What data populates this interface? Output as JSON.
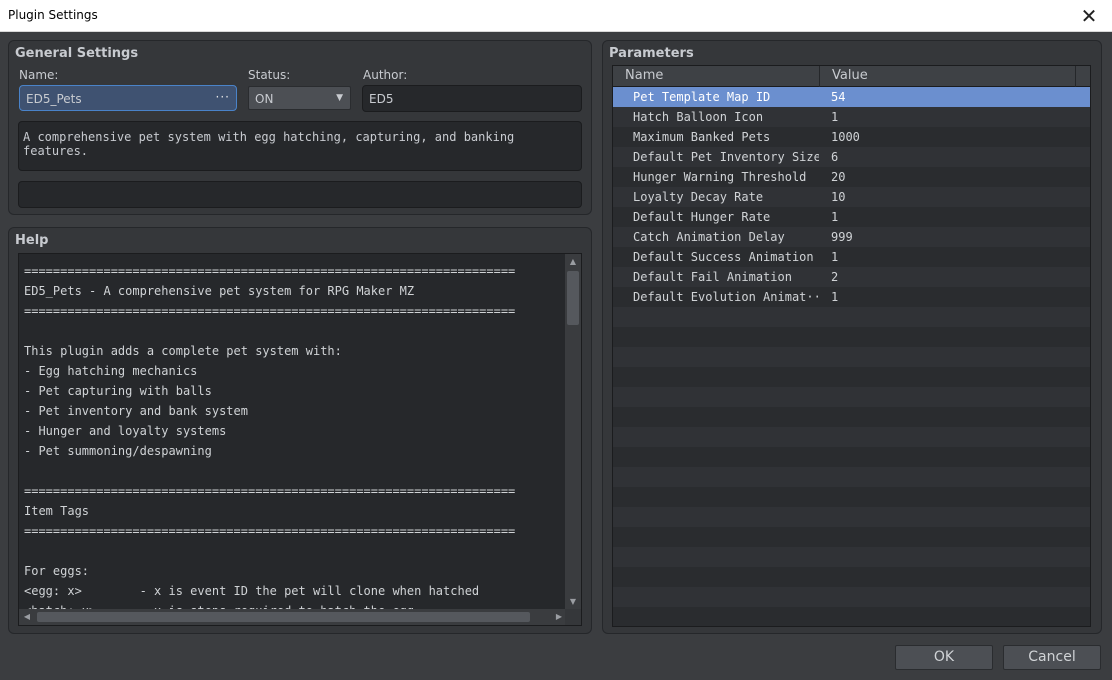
{
  "window": {
    "title": "Plugin Settings",
    "close_glyph": "✕"
  },
  "general": {
    "title": "General Settings",
    "name_label": "Name:",
    "name_value": "ED5_Pets",
    "name_dots": "···",
    "status_label": "Status:",
    "status_value": "ON",
    "author_label": "Author:",
    "author_value": "ED5",
    "description": "A comprehensive pet system with egg hatching, capturing, and banking features.",
    "extra_value": ""
  },
  "help": {
    "title": "Help",
    "lines": [
      "====================================================================",
      "ED5_Pets - A comprehensive pet system for RPG Maker MZ",
      "====================================================================",
      "",
      "This plugin adds a complete pet system with:",
      "- Egg hatching mechanics",
      "- Pet capturing with balls",
      "- Pet inventory and bank system",
      "- Hunger and loyalty systems",
      "- Pet summoning/despawning",
      "",
      "====================================================================",
      "Item Tags",
      "====================================================================",
      "",
      "For eggs:",
      "<egg: x>        - x is event ID the pet will clone when hatched",
      "<hatch: x>      - x is steps required to hatch the egg"
    ]
  },
  "parameters": {
    "title": "Parameters",
    "columns": [
      "Name",
      "Value"
    ],
    "rows": [
      {
        "name": "Pet Template Map ID",
        "value": "54"
      },
      {
        "name": "Hatch Balloon Icon",
        "value": "1"
      },
      {
        "name": "Maximum Banked Pets",
        "value": "1000"
      },
      {
        "name": "Default Pet Inventory Size",
        "value": "6"
      },
      {
        "name": "Hunger Warning Threshold",
        "value": "20"
      },
      {
        "name": "Loyalty Decay Rate",
        "value": "10"
      },
      {
        "name": "Default Hunger Rate",
        "value": "1"
      },
      {
        "name": "Catch Animation Delay",
        "value": "999"
      },
      {
        "name": "Default Success Animation",
        "value": "1"
      },
      {
        "name": "Default Fail Animation",
        "value": "2"
      },
      {
        "name": "Default Evolution Animat···",
        "value": "1"
      },
      {
        "name": "",
        "value": ""
      },
      {
        "name": "",
        "value": ""
      },
      {
        "name": "",
        "value": ""
      },
      {
        "name": "",
        "value": ""
      },
      {
        "name": "",
        "value": ""
      },
      {
        "name": "",
        "value": ""
      },
      {
        "name": "",
        "value": ""
      },
      {
        "name": "",
        "value": ""
      },
      {
        "name": "",
        "value": ""
      },
      {
        "name": "",
        "value": ""
      },
      {
        "name": "",
        "value": ""
      },
      {
        "name": "",
        "value": ""
      },
      {
        "name": "",
        "value": ""
      },
      {
        "name": "",
        "value": ""
      },
      {
        "name": "",
        "value": ""
      },
      {
        "name": "",
        "value": ""
      },
      {
        "name": "",
        "value": ""
      }
    ],
    "selected_index": 0
  },
  "buttons": {
    "ok": "OK",
    "cancel": "Cancel"
  },
  "icons": {
    "scroll_up": "▲",
    "scroll_down": "▼",
    "scroll_left": "◀",
    "scroll_right": "▶",
    "dropdown": "▼"
  }
}
